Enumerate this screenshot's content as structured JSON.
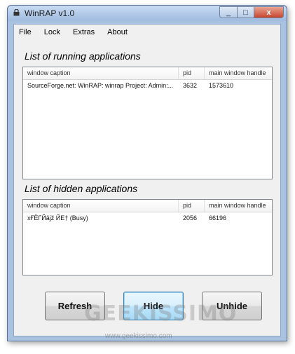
{
  "window": {
    "title": "WinRAP v1.0",
    "close_glyph": "x",
    "min_glyph": "_",
    "max_glyph": "□"
  },
  "menu": [
    {
      "label": "File"
    },
    {
      "label": "Lock"
    },
    {
      "label": "Extras"
    },
    {
      "label": "About"
    }
  ],
  "running": {
    "title": "List of running applications",
    "columns": [
      "window caption",
      "pid",
      "main window handle"
    ],
    "rows": [
      {
        "caption": "SourceForge.net: WinRAP: winrap Project: Admin:...",
        "pid": "3632",
        "handle": "1573610"
      }
    ]
  },
  "hidden": {
    "title": "List of hidden applications",
    "columns": [
      "window caption",
      "pid",
      "main window handle"
    ],
    "rows": [
      {
        "caption": "xҒЁГЙäјž ЙЕ† (Busy)",
        "pid": "2056",
        "handle": "66196"
      }
    ]
  },
  "buttons": {
    "refresh": "Refresh",
    "hide": "Hide",
    "unhide": "Unhide"
  },
  "watermark": {
    "brand": "GEEKISSIMO",
    "url": "www.geekissimo.com"
  },
  "icons": {
    "app": "lock-icon"
  },
  "colors": {
    "titlebar": "#a9c2e0",
    "close": "#c8452c",
    "focus_border": "#3c7fb1"
  }
}
